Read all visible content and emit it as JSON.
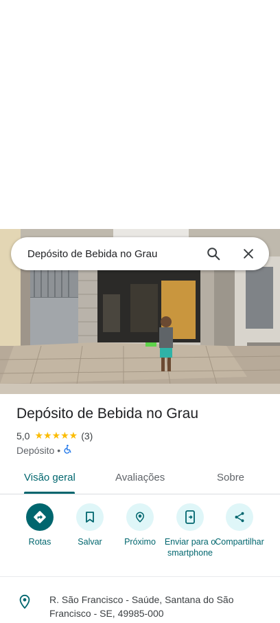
{
  "search": {
    "query": "Depósito de Bebida no Grau"
  },
  "place": {
    "name": "Depósito de Bebida no Grau",
    "rating": "5,0",
    "stars": "★★★★★",
    "reviews_count": "(3)",
    "category": "Depósito",
    "separator": "•",
    "accessible_icon": "wheelchair-icon"
  },
  "tabs": [
    {
      "label": "Visão geral",
      "active": true
    },
    {
      "label": "Avaliações",
      "active": false
    },
    {
      "label": "Sobre",
      "active": false
    }
  ],
  "actions": [
    {
      "label": "Rotas",
      "icon": "directions-icon"
    },
    {
      "label": "Salvar",
      "icon": "bookmark-icon"
    },
    {
      "label": "Próximo",
      "icon": "nearby-icon"
    },
    {
      "label": "Enviar para o smartphone",
      "icon": "send-to-phone-icon"
    },
    {
      "label": "Compartilhar",
      "icon": "share-icon"
    }
  ],
  "address": {
    "icon": "location-pin-icon",
    "text": "R. São Francisco - Saúde, Santana do São Francisco - SE, 49985-000"
  },
  "colors": {
    "accent": "#00666e",
    "action_bg": "#dff6f8",
    "star": "#fbbc04"
  }
}
